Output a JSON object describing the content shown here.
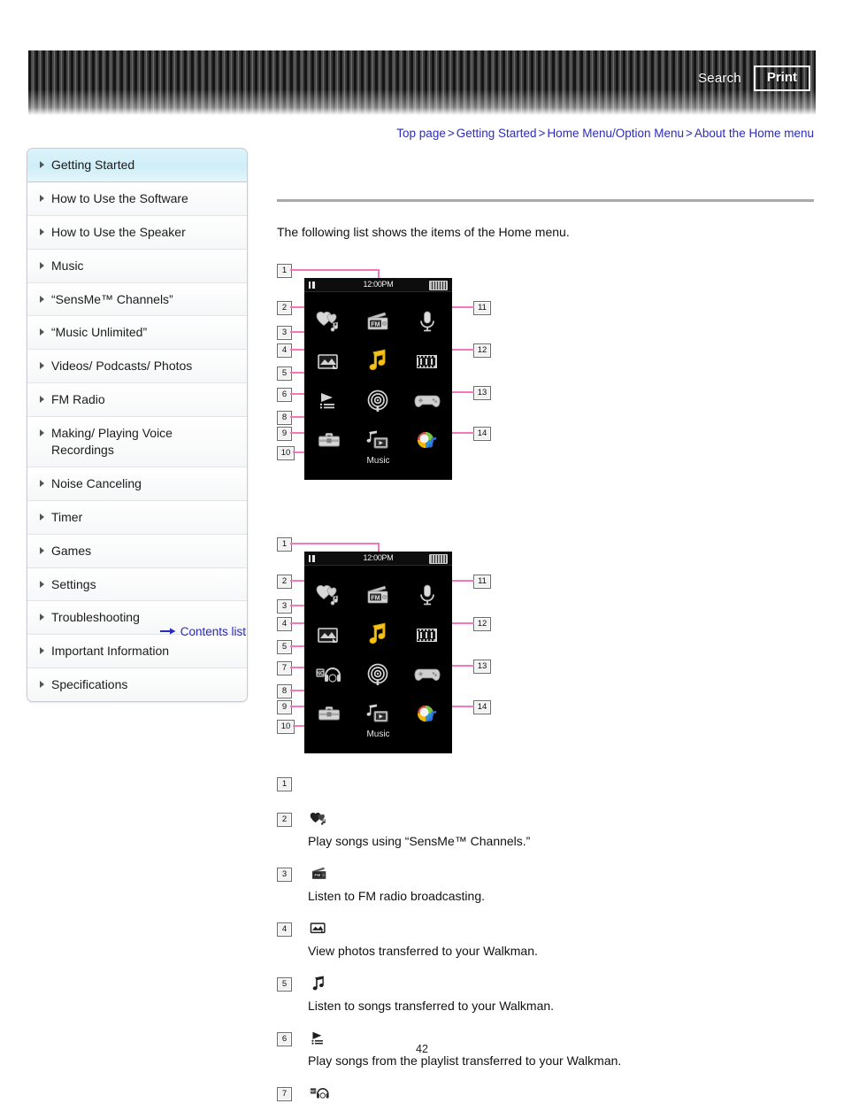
{
  "header": {
    "search_label": "Search",
    "print_label": "Print"
  },
  "breadcrumb": {
    "items": [
      {
        "label": "Top page"
      },
      {
        "label": "Getting Started"
      },
      {
        "label": "Home Menu/Option Menu"
      },
      {
        "label": "About the Home menu"
      }
    ],
    "separator": ">"
  },
  "sidebar": {
    "items": [
      {
        "label": "Getting Started",
        "active": true
      },
      {
        "label": "How to Use the Software",
        "active": false
      },
      {
        "label": "How to Use the Speaker",
        "active": false
      },
      {
        "label": "Music",
        "active": false
      },
      {
        "label": "“SensMe™ Channels”",
        "active": false
      },
      {
        "label": "“Music Unlimited”",
        "active": false
      },
      {
        "label": "Videos/ Podcasts/ Photos",
        "active": false
      },
      {
        "label": "FM Radio",
        "active": false
      },
      {
        "label": "Making/ Playing Voice Recordings",
        "active": false
      },
      {
        "label": "Noise Canceling",
        "active": false
      },
      {
        "label": "Timer",
        "active": false
      },
      {
        "label": "Games",
        "active": false
      },
      {
        "label": "Settings",
        "active": false
      },
      {
        "label": "Troubleshooting",
        "active": false
      },
      {
        "label": "Important Information",
        "active": false
      },
      {
        "label": "Specifications",
        "active": false
      }
    ],
    "contents_link": "Contents list"
  },
  "main": {
    "intro": "The following list shows the items of the Home menu.",
    "figures": [
      {
        "status": {
          "time": "12:00PM"
        },
        "music_label": "Music",
        "left_callouts": [
          "2",
          "3",
          "4",
          "5",
          "6",
          "8",
          "9",
          "10"
        ],
        "right_callouts": [
          "11",
          "12",
          "13",
          "14"
        ],
        "top_callout": "1"
      },
      {
        "status": {
          "time": "12:00PM"
        },
        "music_label": "Music",
        "left_callouts": [
          "2",
          "3",
          "4",
          "5",
          "7",
          "8",
          "9",
          "10"
        ],
        "right_callouts": [
          "11",
          "12",
          "13",
          "14"
        ],
        "top_callout": "1"
      }
    ],
    "legend": [
      {
        "num": "1",
        "icon": "",
        "desc": ""
      },
      {
        "num": "2",
        "icon": "sensme-heart-icon",
        "desc": "Play songs using “SensMe™ Channels.”"
      },
      {
        "num": "3",
        "icon": "fm-radio-icon",
        "desc": "Listen to FM radio broadcasting."
      },
      {
        "num": "4",
        "icon": "photo-icon",
        "desc": "View photos transferred to your Walkman."
      },
      {
        "num": "5",
        "icon": "music-note-icon",
        "desc": "Listen to songs transferred to your Walkman."
      },
      {
        "num": "6",
        "icon": "playlist-icon",
        "desc": "Play songs from the playlist transferred to your Walkman."
      },
      {
        "num": "7",
        "icon": "noise-canceling-icon",
        "desc": ""
      }
    ]
  },
  "page": {
    "number": "42"
  },
  "colors": {
    "link": "#2b2bbd",
    "callout_line": "#f277bb",
    "sidebar_active": "#cfeef8",
    "rule": "#a9a9a9"
  }
}
